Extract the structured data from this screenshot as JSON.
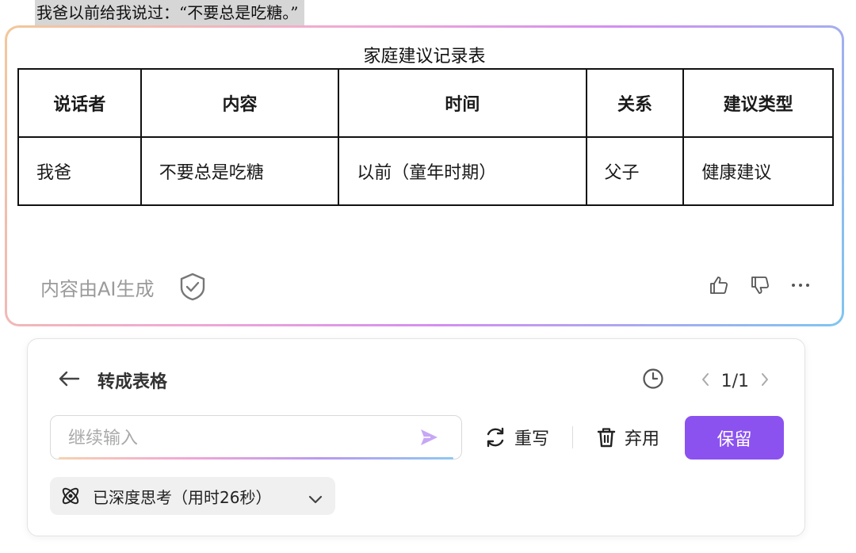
{
  "selected_text": "我爸以前给我说过：“不要总是吃糖。”",
  "ai_card": {
    "table_title": "家庭建议记录表",
    "table": {
      "headers": [
        "说话者",
        "内容",
        "时间",
        "关系",
        "建议类型"
      ],
      "rows": [
        [
          "我爸",
          "不要总是吃糖",
          "以前（童年时期）",
          "父子",
          "健康建议"
        ]
      ]
    },
    "footer_label": "内容由AI生成",
    "icons": {
      "shield": "shield-check-icon",
      "like": "thumbs-up-icon",
      "dislike": "thumbs-down-icon",
      "more": "more-horizontal-icon"
    }
  },
  "panel": {
    "title": "转成表格",
    "pager": "1/1",
    "input_placeholder": "继续输入",
    "rewrite_label": "重写",
    "discard_label": "弃用",
    "keep_label": "保留",
    "thinking_label": "已深度思考（用时26秒）"
  },
  "colors": {
    "accent": "#8b52f0",
    "send_icon": "#c7a6f5"
  }
}
